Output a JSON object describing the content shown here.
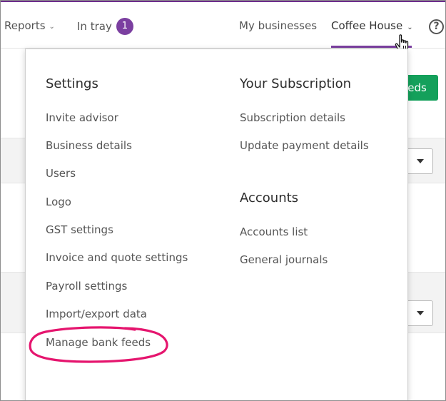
{
  "nav": {
    "reports_label": "Reports",
    "intray_label": "In tray",
    "intray_count": "1",
    "my_businesses_label": "My businesses",
    "business_name": "Coffee House",
    "help_symbol": "?"
  },
  "background": {
    "green_button_fragment": "eeds"
  },
  "dropdown": {
    "settings": {
      "heading": "Settings",
      "items": [
        "Invite advisor",
        "Business details",
        "Users",
        "Logo",
        "GST settings",
        "Invoice and quote settings",
        "Payroll settings",
        "Import/export data",
        "Manage bank feeds"
      ]
    },
    "subscription": {
      "heading": "Your Subscription",
      "items": [
        "Subscription details",
        "Update payment details"
      ]
    },
    "accounts": {
      "heading": "Accounts",
      "items": [
        "Accounts list",
        "General journals"
      ]
    }
  },
  "colors": {
    "accent_purple": "#7b3fa0",
    "highlight_pink": "#e5156e",
    "green_button": "#14a05b"
  }
}
